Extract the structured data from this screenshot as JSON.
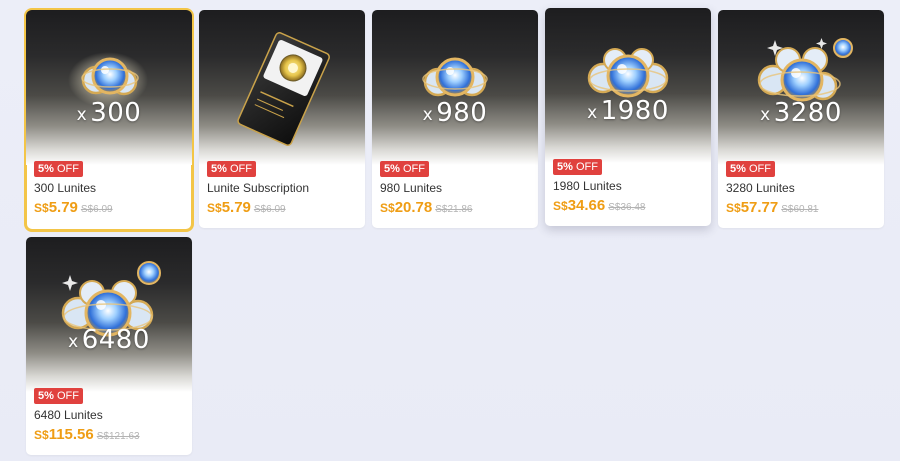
{
  "products": [
    {
      "quantity": "300",
      "x_label": "x",
      "badge_pct": "5%",
      "badge_off": "OFF",
      "name": "300 Lunites",
      "currency": "S$",
      "price": "5.79",
      "original_price": "S$6.09",
      "art": "lunite-orbs-small-icon",
      "selected": true
    },
    {
      "quantity": "",
      "x_label": "",
      "badge_pct": "5%",
      "badge_off": "OFF",
      "name": "Lunite Subscription",
      "currency": "S$",
      "price": "5.79",
      "original_price": "S$6.09",
      "art": "subscription-card-icon",
      "selected": false
    },
    {
      "quantity": "980",
      "x_label": "x",
      "badge_pct": "5%",
      "badge_off": "OFF",
      "name": "980 Lunites",
      "currency": "S$",
      "price": "20.78",
      "original_price": "S$21.86",
      "art": "lunite-orbs-small-icon",
      "selected": false
    },
    {
      "quantity": "1980",
      "x_label": "x",
      "badge_pct": "5%",
      "badge_off": "OFF",
      "name": "1980 Lunites",
      "currency": "S$",
      "price": "34.66",
      "original_price": "S$36.48",
      "art": "lunite-orbs-medium-icon",
      "selected": false
    },
    {
      "quantity": "3280",
      "x_label": "x",
      "badge_pct": "5%",
      "badge_off": "OFF",
      "name": "3280 Lunites",
      "currency": "S$",
      "price": "57.77",
      "original_price": "S$60.81",
      "art": "lunite-orbs-large-icon",
      "selected": false
    },
    {
      "quantity": "6480",
      "x_label": "x",
      "badge_pct": "5%",
      "badge_off": "OFF",
      "name": "6480 Lunites",
      "currency": "S$",
      "price": "115.56",
      "original_price": "S$121.63",
      "art": "lunite-orbs-large-icon",
      "selected": false
    }
  ],
  "colors": {
    "price_accent": "#ef9d14",
    "badge_bg": "#e0413e",
    "selected_outline": "#f3c548",
    "page_bg": "#eceef8"
  }
}
